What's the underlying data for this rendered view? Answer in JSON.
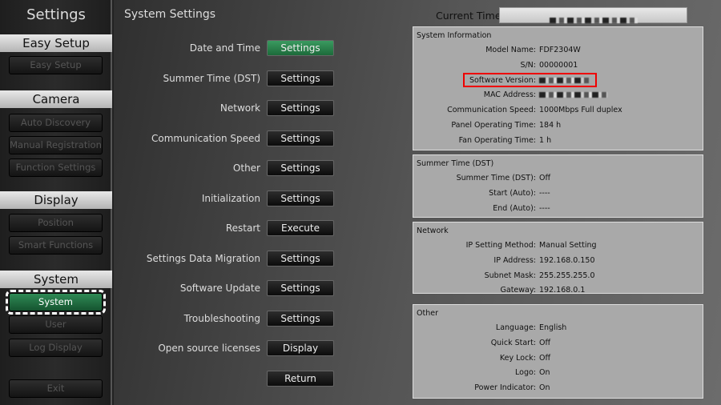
{
  "sidebar": {
    "title": "Settings",
    "sections": [
      {
        "label": "Easy Setup",
        "items": [
          "Easy Setup"
        ]
      },
      {
        "label": "Camera",
        "items": [
          "Auto Discovery",
          "Manual Registration",
          "Function Settings"
        ]
      },
      {
        "label": "Display",
        "items": [
          "Position",
          "Smart Functions"
        ]
      },
      {
        "label": "System",
        "items": [
          "System",
          "User",
          "Log Display"
        ]
      }
    ],
    "active": "System",
    "exit": "Exit"
  },
  "main": {
    "title": "System Settings",
    "rows": [
      {
        "label": "Date and Time",
        "button": "Settings",
        "highlight": true
      },
      {
        "label": "Summer Time (DST)",
        "button": "Settings"
      },
      {
        "label": "Network",
        "button": "Settings"
      },
      {
        "label": "Communication Speed",
        "button": "Settings"
      },
      {
        "label": "Other",
        "button": "Settings"
      },
      {
        "label": "Initialization",
        "button": "Settings"
      },
      {
        "label": "Restart",
        "button": "Execute"
      },
      {
        "label": "Settings Data Migration",
        "button": "Settings"
      },
      {
        "label": "Software Update",
        "button": "Settings"
      },
      {
        "label": "Troubleshooting",
        "button": "Settings"
      },
      {
        "label": "Open source licenses",
        "button": "Display"
      },
      {
        "label": "",
        "button": "Return"
      }
    ]
  },
  "current_time": {
    "label": "Current Time"
  },
  "panels": [
    {
      "title": "System Information",
      "rows": [
        [
          "Model Name:",
          "FDF2304W"
        ],
        [
          "S/N:",
          "00000001"
        ],
        [
          "Software Version:",
          ""
        ],
        [
          "MAC Address:",
          ""
        ],
        [
          "Communication Speed:",
          "1000Mbps Full duplex"
        ],
        [
          "Panel Operating Time:",
          "184 h"
        ],
        [
          "Fan Operating Time:",
          "1 h"
        ]
      ]
    },
    {
      "title": "Summer Time (DST)",
      "rows": [
        [
          "Summer Time (DST):",
          "Off"
        ],
        [
          "Start (Auto):",
          "----"
        ],
        [
          "End (Auto):",
          "----"
        ]
      ]
    },
    {
      "title": "Network",
      "rows": [
        [
          "IP Setting Method:",
          "Manual Setting"
        ],
        [
          "IP Address:",
          "192.168.0.150"
        ],
        [
          "Subnet Mask:",
          "255.255.255.0"
        ],
        [
          "Gateway:",
          "192.168.0.1"
        ]
      ]
    },
    {
      "title": "Other",
      "rows": [
        [
          "Language:",
          "English"
        ],
        [
          "Quick Start:",
          "Off"
        ],
        [
          "Key Lock:",
          "Off"
        ],
        [
          "Logo:",
          "On"
        ],
        [
          "Power Indicator:",
          "On"
        ]
      ]
    }
  ],
  "highlight_color": "#e00000",
  "active_color": "#2f8a55"
}
